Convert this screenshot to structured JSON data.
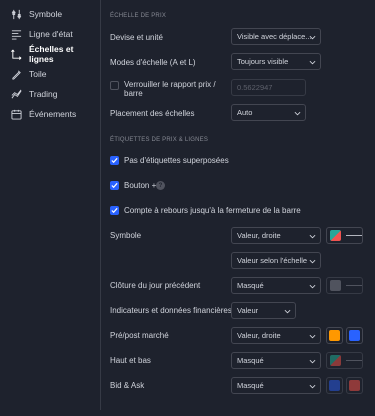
{
  "sidebar": {
    "items": [
      {
        "label": "Symbole",
        "icon": "symbol-settings-icon",
        "active": false
      },
      {
        "label": "Ligne d'état",
        "icon": "status-line-icon",
        "active": false
      },
      {
        "label": "Échelles et lignes",
        "icon": "scales-lines-icon",
        "active": true
      },
      {
        "label": "Toile",
        "icon": "canvas-icon",
        "active": false
      },
      {
        "label": "Trading",
        "icon": "trading-icon",
        "active": false
      },
      {
        "label": "Événements",
        "icon": "events-calendar-icon",
        "active": false
      }
    ]
  },
  "scales": {
    "section_title": "ÉCHELLE DE PRIX",
    "currency_label": "Devise et unité",
    "currency_value": "Visible avec déplace...",
    "mode_label": "Modes d'échelle (A et L)",
    "mode_value": "Toujours visible",
    "lock_label": "Verrouiller le rapport prix / barre",
    "lock_value": "0.5622947",
    "lock_checked": false,
    "placement_label": "Placement des échelles",
    "placement_value": "Auto"
  },
  "labels": {
    "section_title": "ÉTIQUETTES DE PRIX & LIGNES",
    "no_overlap_label": "Pas d'étiquettes superposées",
    "plus_button_label": "Bouton +",
    "help_glyph": "?",
    "countdown_label": "Compte à rebours jusqu'à la fermeture de la barre",
    "symbol_label": "Symbole",
    "symbol_value": "Valeur, droite",
    "symbol_value2": "Valeur selon l'échelle",
    "prev_close_label": "Clôture du jour précédent",
    "prev_close_value": "Masqué",
    "indicators_label": "Indicateurs et données financières",
    "indicators_value": "Valeur",
    "prepost_label": "Pré/post marché",
    "prepost_value": "Valeur, droite",
    "highlow_label": "Haut et bas",
    "highlow_value": "Masqué",
    "bidask_label": "Bid & Ask",
    "bidask_value": "Masqué"
  },
  "colors": {
    "accent": "#2962ff",
    "symbol_swatch_a": "#26a69a",
    "symbol_swatch_b": "#ef5350",
    "prepost_color_1": "#ff9800",
    "prepost_color_2": "#2962ff",
    "highlow_swatch": "#b2b5be",
    "bid_color": "#2962ff",
    "ask_color": "#ef5350"
  }
}
